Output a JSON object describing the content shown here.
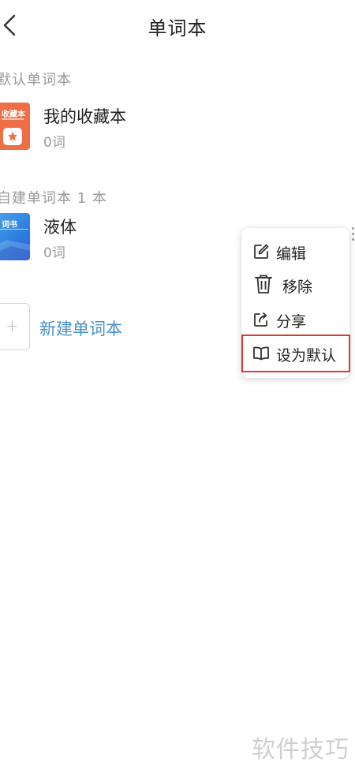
{
  "header": {
    "title": "单词本",
    "back_icon": "chevron-left-icon"
  },
  "sections": {
    "default_title": "默认单词本",
    "custom_title": "自建单词本 1 本"
  },
  "books": [
    {
      "name": "我的收藏本",
      "count": "0词",
      "cover_text": "收藏本",
      "cover_color": "#ee6f45"
    },
    {
      "name": "液体",
      "count": "0词",
      "cover_text": "词书",
      "cover_color": "#2f7fe0"
    }
  ],
  "new_book": {
    "plus": "+",
    "label": "新建单词本"
  },
  "menu": {
    "items": [
      {
        "label": "编辑",
        "icon": "edit-icon"
      },
      {
        "label": "移除",
        "icon": "trash-icon"
      },
      {
        "label": "分享",
        "icon": "share-icon"
      },
      {
        "label": "设为默认",
        "icon": "book-icon"
      }
    ],
    "highlight_color": "#d83a35"
  },
  "watermark": "软件技巧",
  "colors": {
    "accent_link": "#4a90c8",
    "muted_text": "#9a9a9a"
  }
}
